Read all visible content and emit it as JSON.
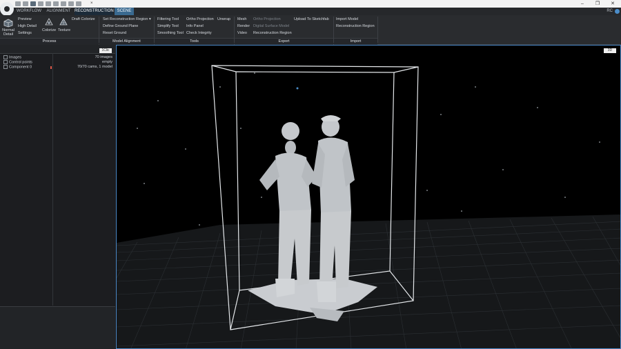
{
  "titlebar": {
    "label": "×",
    "window_buttons": [
      "–",
      "❐",
      "✕"
    ]
  },
  "tabs": [
    "WORKFLOW",
    "ALIGNMENT",
    "RECONSTRUCTION",
    "SCENE"
  ],
  "user": "RC",
  "ribbon": {
    "process": {
      "normal_detail": "Normal Detail",
      "preview": "Preview",
      "high_detail": "High Detail",
      "settings": "Settings",
      "colorize": "Colorize",
      "texture": "Texture",
      "draft_colorize": "Draft Colorize",
      "group_label": "Process"
    },
    "model_alignment": {
      "set_region": "Set Reconstruction Region ▾",
      "define_ground": "Define Ground Plane",
      "reset_ground": "Reset Ground",
      "group_label": "Model Alignment"
    },
    "tools": {
      "filtering": "Filtering Tool",
      "simplify": "Simplify Tool",
      "smoothing": "Smoothing Tool",
      "ortho": "Ortho Projection",
      "unwrap": "Unwrap",
      "info_panel": "Info Panel",
      "check_integrity": "Check Integrity",
      "group_label": "Tools"
    },
    "export": {
      "mesh": "Mesh",
      "render": "Render",
      "video": "Video",
      "ortho": "Ortho Projection",
      "dsm": "Digital Surface Model",
      "region": "Reconstruction Region",
      "sketchfab": "Upload To Sketchfab",
      "group_label": "Export"
    },
    "import": {
      "model": "Import Model",
      "region": "Reconstruction Region",
      "group_label": "Import"
    }
  },
  "left_panel": {
    "button": "1Clic",
    "items": [
      {
        "label": "Images",
        "value": "70 images"
      },
      {
        "label": "Control points",
        "value": "empty"
      },
      {
        "label": "Component 0",
        "value": "70/70 cams, 1 model"
      }
    ]
  },
  "viewport": {
    "button": "3D",
    "accent_color": "#4a88c7"
  }
}
